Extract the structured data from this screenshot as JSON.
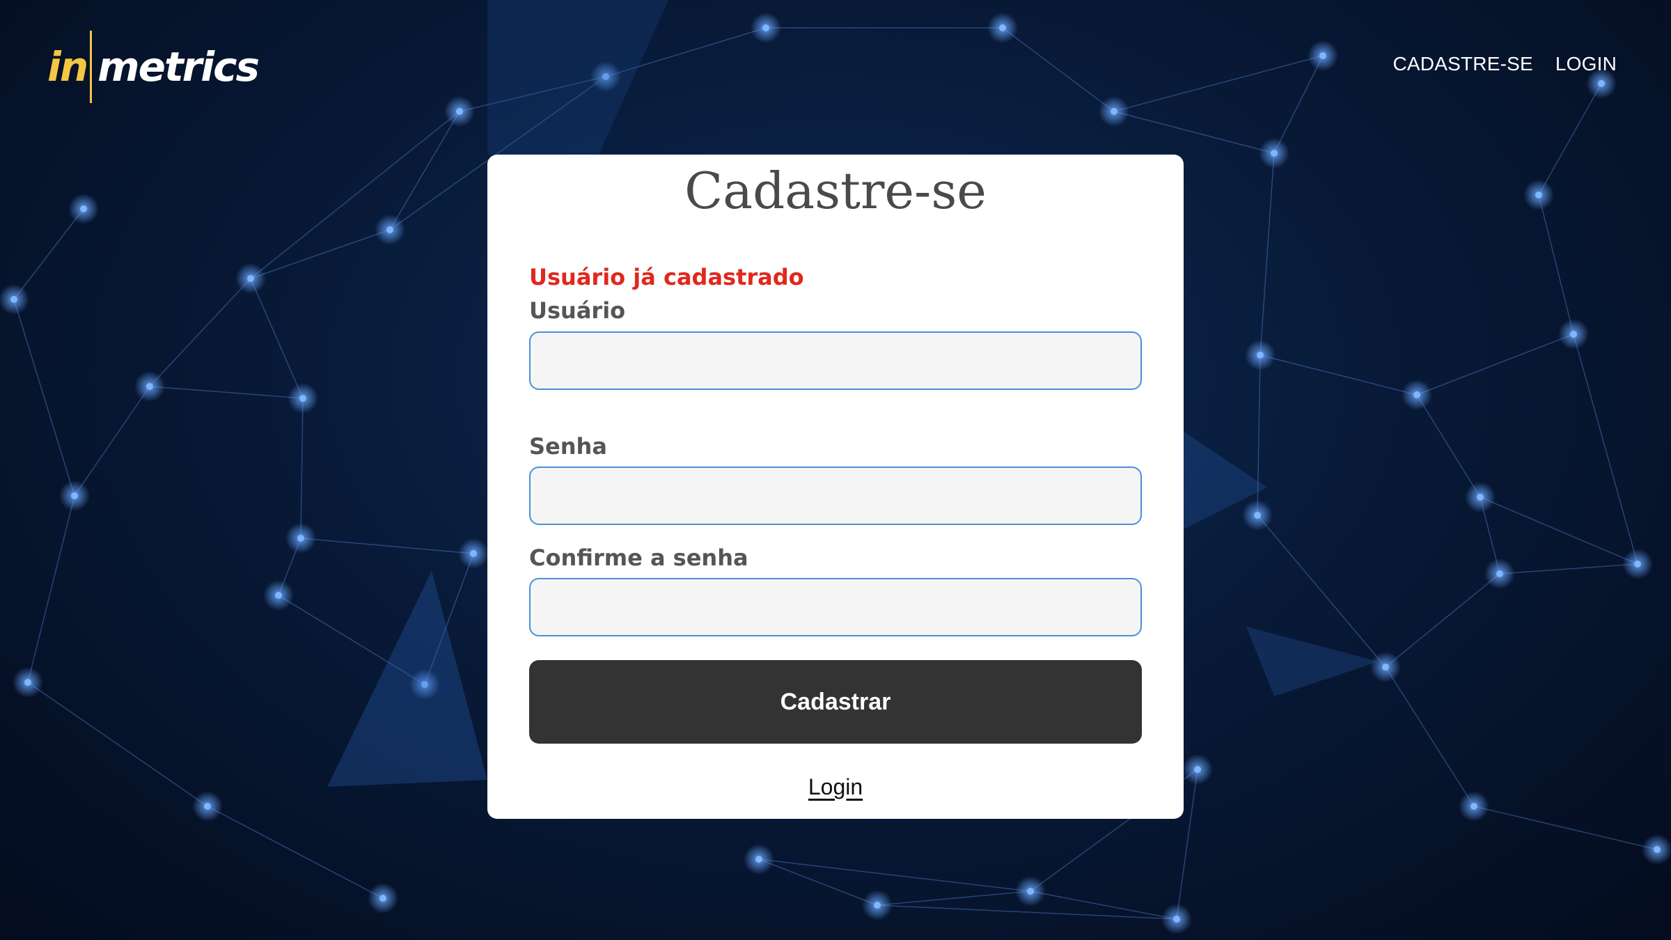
{
  "brand": {
    "logo_part1": "in",
    "logo_part2": "metrics",
    "accent_color": "#f3c744"
  },
  "nav": {
    "items": [
      {
        "label": "CADASTRE-SE"
      },
      {
        "label": "LOGIN"
      }
    ]
  },
  "form": {
    "title": "Cadastre-se",
    "error": "Usuário já cadastrado",
    "error_color": "#e0281e",
    "fields": {
      "username": {
        "label": "Usuário",
        "value": ""
      },
      "password": {
        "label": "Senha",
        "value": ""
      },
      "confirm": {
        "label": "Confirme a senha",
        "value": ""
      }
    },
    "submit_label": "Cadastrar",
    "login_link": "Login"
  },
  "colors": {
    "background": "#081a38",
    "button": "#333333",
    "input_border": "#4d8fda"
  }
}
